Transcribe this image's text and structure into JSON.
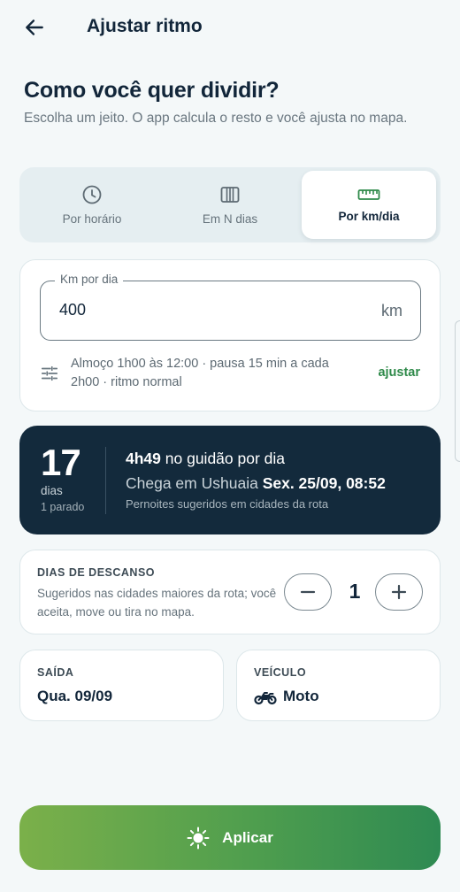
{
  "header": {
    "title": "Ajustar ritmo"
  },
  "intro": {
    "question": "Como você quer dividir?",
    "subtitle": "Escolha um jeito. O app calcula o resto e você ajusta no mapa."
  },
  "modes": [
    {
      "label": "Por horário",
      "icon": "clock-icon",
      "active": false
    },
    {
      "label": "Em N dias",
      "icon": "calendar-columns-icon",
      "active": false
    },
    {
      "label": "Por km/dia",
      "icon": "ruler-icon",
      "active": true
    }
  ],
  "km_card": {
    "field_label": "Km por dia",
    "value": "400",
    "unit": "km",
    "schedule_text": "Almoço 1h00 às 12:00 · pausa 15 min a cada 2h00 · ritmo normal",
    "adjust_link": "ajustar"
  },
  "summary": {
    "days": "17",
    "days_unit": "dias",
    "stopped": "1 parado",
    "ride_time": "4h49",
    "ride_suffix": "no guidão por dia",
    "arrive_prefix": "Chega em Ushuaia",
    "arrive_date": "Sex. 25/09, 08:52",
    "overnight_note": "Pernoites sugeridos em cidades da rota"
  },
  "rest_days": {
    "title": "DIAS DE DESCANSO",
    "description": "Sugeridos nas cidades maiores da rota; você aceita, move ou tira no mapa.",
    "value": "1"
  },
  "departure": {
    "title": "SAÍDA",
    "value": "Qua. 09/09"
  },
  "vehicle": {
    "title": "VEÍCULO",
    "value": "Moto",
    "icon": "motorcycle-icon"
  },
  "apply_button": {
    "label": "Aplicar",
    "icon": "sun-icon"
  },
  "colors": {
    "accent_green": "#2f8a4a",
    "dark_card": "#132a3c",
    "background": "#f4f8f9",
    "text_dark": "#12263a"
  }
}
